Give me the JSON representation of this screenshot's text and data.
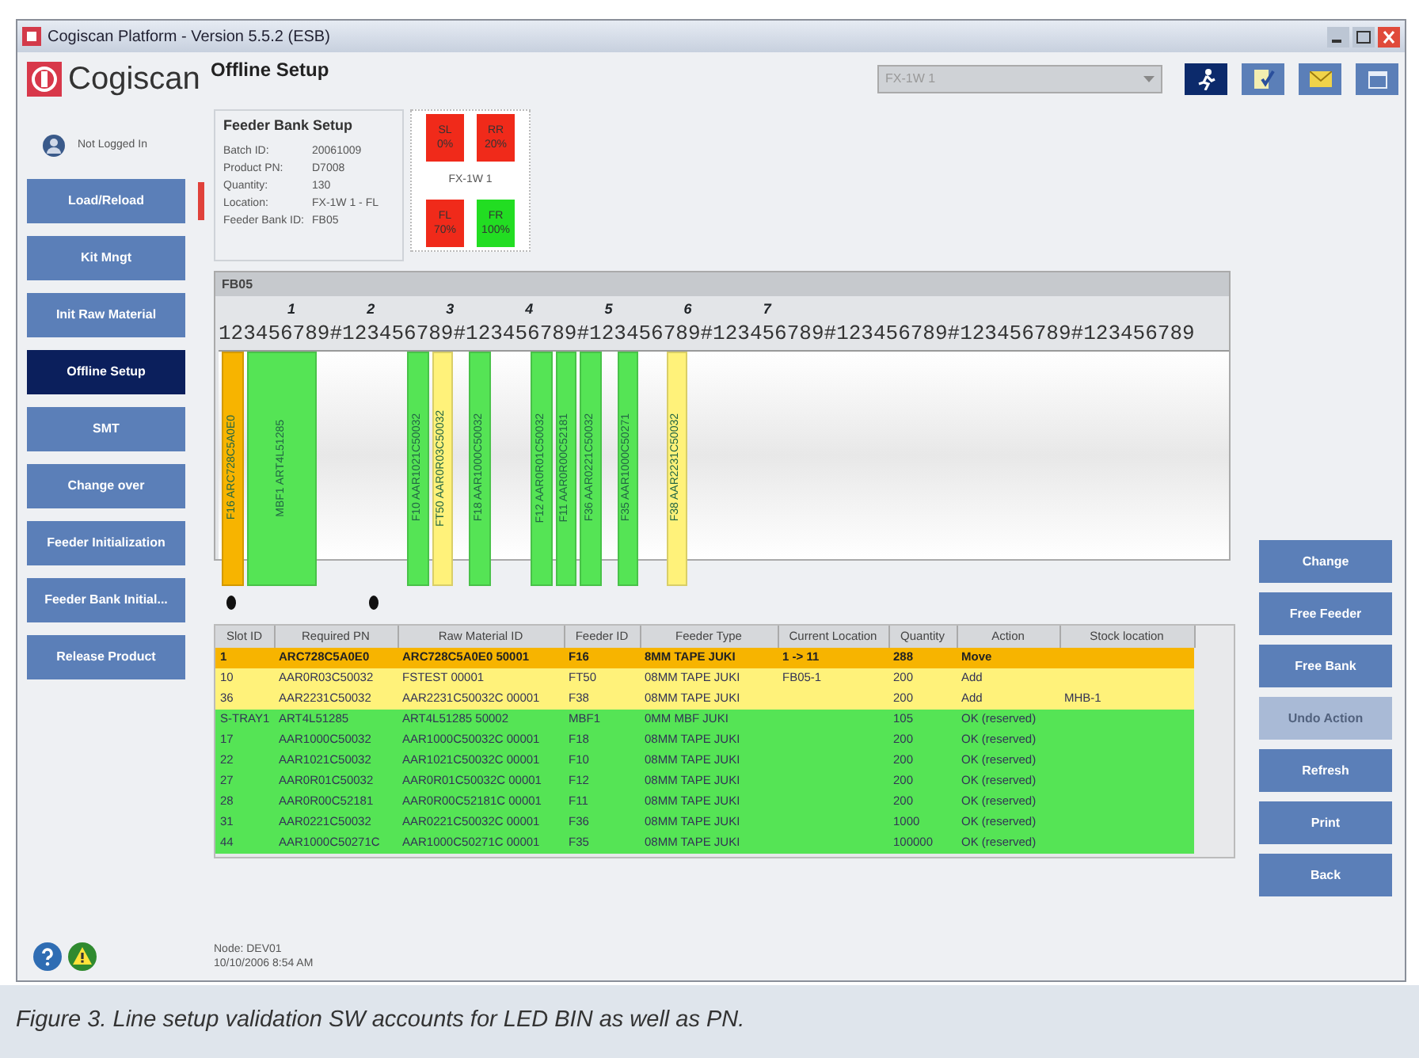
{
  "window": {
    "title": "Cogiscan Platform - Version 5.5.2 (ESB)"
  },
  "logo": {
    "text": "Cogiscan"
  },
  "page_title": "Offline Setup",
  "combo": {
    "value": "FX-1W 1"
  },
  "user": {
    "label": "Not Logged In"
  },
  "sidebar": {
    "items": [
      {
        "label": "Load/Reload",
        "selected": false,
        "current": true
      },
      {
        "label": "Kit Mngt",
        "selected": false,
        "current": false
      },
      {
        "label": "Init Raw Material",
        "selected": false,
        "current": false
      },
      {
        "label": "Offline Setup",
        "selected": true,
        "current": false
      },
      {
        "label": "SMT",
        "selected": false,
        "current": false
      },
      {
        "label": "Change over",
        "selected": false,
        "current": false
      },
      {
        "label": "Feeder Initialization",
        "selected": false,
        "current": false
      },
      {
        "label": "Feeder Bank Initial...",
        "selected": false,
        "current": false
      },
      {
        "label": "Release Product",
        "selected": false,
        "current": false
      }
    ]
  },
  "feeder_bank_setup": {
    "title": "Feeder Bank Setup",
    "fields": [
      {
        "label": "Batch ID:",
        "value": "20061009"
      },
      {
        "label": "Product PN:",
        "value": "D7008"
      },
      {
        "label": "Quantity:",
        "value": "130"
      },
      {
        "label": "Location:",
        "value": "FX-1W 1 - FL"
      },
      {
        "label": "Feeder Bank ID:",
        "value": "FB05"
      }
    ]
  },
  "bank_diagram": {
    "label": "FX-1W 1",
    "positions": [
      {
        "code": "SL",
        "percent": "0%",
        "color": "#f02a1a"
      },
      {
        "code": "RR",
        "percent": "20%",
        "color": "#f02a1a"
      },
      {
        "code": "FL",
        "percent": "70%",
        "color": "#f02a1a"
      },
      {
        "code": "FR",
        "percent": "100%",
        "color": "#22dd22"
      }
    ]
  },
  "feeder_panel": {
    "title": "FB05",
    "major_ticks": [
      "1",
      "2",
      "3",
      "4",
      "5",
      "6",
      "7"
    ],
    "digits": "123456789#123456789#123456789#123456789#123456789#123456789#123456789#123456789",
    "feeders": [
      {
        "label": "F16 ARC728C5A0E0",
        "color": "#f7b400"
      },
      {
        "label": "MBF1 ART4L51285",
        "color": "#55e455"
      },
      {
        "label": "F10 AAR1021C50032",
        "color": "#55e455"
      },
      {
        "label": "FT50 AAR0R03C50032",
        "color": "#fff27a"
      },
      {
        "label": "F18 AAR1000C50032",
        "color": "#55e455"
      },
      {
        "label": "F12 AAR0R01C50032",
        "color": "#55e455"
      },
      {
        "label": "F11 AAR0R00C52181",
        "color": "#55e455"
      },
      {
        "label": "F36 AAR0221C50032",
        "color": "#55e455"
      },
      {
        "label": "F35 AAR1000C50271",
        "color": "#55e455"
      },
      {
        "label": "F38 AAR2231C50032",
        "color": "#fff27a"
      }
    ]
  },
  "table": {
    "columns": [
      "Slot ID",
      "Required PN",
      "Raw Material ID",
      "Feeder ID",
      "Feeder Type",
      "Current Location",
      "Quantity",
      "Action",
      "Stock location"
    ],
    "rows": [
      {
        "color": "#f7b400",
        "bold": true,
        "cells": [
          "1",
          "ARC728C5A0E0",
          "ARC728C5A0E0 50001",
          "F16",
          "8MM TAPE JUKI",
          "1 -> 11",
          "288",
          "Move",
          ""
        ]
      },
      {
        "color": "#fff27a",
        "bold": false,
        "cells": [
          "10",
          "AAR0R03C50032",
          "FSTEST 00001",
          "FT50",
          "08MM TAPE JUKI",
          "FB05-1",
          "200",
          "Add",
          ""
        ]
      },
      {
        "color": "#fff27a",
        "bold": false,
        "cells": [
          "36",
          "AAR2231C50032",
          "AAR2231C50032C 00001",
          "F38",
          "08MM TAPE JUKI",
          "",
          "200",
          "Add",
          "MHB-1"
        ]
      },
      {
        "color": "#55e455",
        "bold": false,
        "cells": [
          "S-TRAY1",
          "ART4L51285",
          "ART4L51285 50002",
          "MBF1",
          "0MM MBF JUKI",
          "",
          "105",
          "OK (reserved)",
          ""
        ]
      },
      {
        "color": "#55e455",
        "bold": false,
        "cells": [
          "17",
          "AAR1000C50032",
          "AAR1000C50032C 00001",
          "F18",
          "08MM TAPE JUKI",
          "",
          "200",
          "OK (reserved)",
          ""
        ]
      },
      {
        "color": "#55e455",
        "bold": false,
        "cells": [
          "22",
          "AAR1021C50032",
          "AAR1021C50032C 00001",
          "F10",
          "08MM TAPE JUKI",
          "",
          "200",
          "OK (reserved)",
          ""
        ]
      },
      {
        "color": "#55e455",
        "bold": false,
        "cells": [
          "27",
          "AAR0R01C50032",
          "AAR0R01C50032C 00001",
          "F12",
          "08MM TAPE JUKI",
          "",
          "200",
          "OK (reserved)",
          ""
        ]
      },
      {
        "color": "#55e455",
        "bold": false,
        "cells": [
          "28",
          "AAR0R00C52181",
          "AAR0R00C52181C 00001",
          "F11",
          "08MM TAPE JUKI",
          "",
          "200",
          "OK (reserved)",
          ""
        ]
      },
      {
        "color": "#55e455",
        "bold": false,
        "cells": [
          "31",
          "AAR0221C50032",
          "AAR0221C50032C 00001",
          "F36",
          "08MM TAPE JUKI",
          "",
          "1000",
          "OK (reserved)",
          ""
        ]
      },
      {
        "color": "#55e455",
        "bold": false,
        "cells": [
          "44",
          "AAR1000C50271C",
          "AAR1000C50271C 00001",
          "F35",
          "08MM TAPE JUKI",
          "",
          "100000",
          "OK (reserved)",
          ""
        ]
      }
    ]
  },
  "actions": [
    {
      "label": "Change",
      "disabled": false
    },
    {
      "label": "Free Feeder",
      "disabled": false
    },
    {
      "label": "Free Bank",
      "disabled": false
    },
    {
      "label": "Undo Action",
      "disabled": true
    },
    {
      "label": "Refresh",
      "disabled": false
    },
    {
      "label": "Print",
      "disabled": false
    },
    {
      "label": "Back",
      "disabled": false
    }
  ],
  "status_bar": {
    "node": "Node: DEV01",
    "datetime": "10/10/2006 8:54 AM"
  },
  "caption": "Figure 3. Line setup validation SW accounts for LED BIN as well as PN."
}
